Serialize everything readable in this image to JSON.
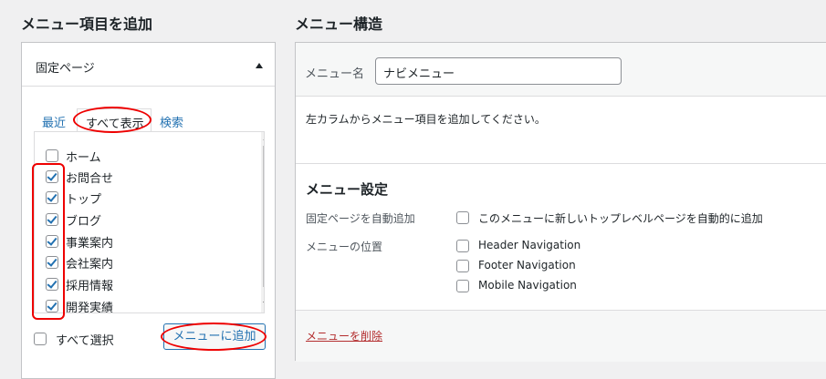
{
  "left": {
    "heading": "メニュー項目を追加",
    "panel_title": "固定ページ",
    "tabs": [
      {
        "label": "最近"
      },
      {
        "label": "すべて表示"
      },
      {
        "label": "検索"
      }
    ],
    "pages": [
      {
        "label": "ホーム",
        "checked": false
      },
      {
        "label": "お問合せ",
        "checked": true
      },
      {
        "label": "トップ",
        "checked": true
      },
      {
        "label": "ブログ",
        "checked": true
      },
      {
        "label": "事業案内",
        "checked": true
      },
      {
        "label": "会社案内",
        "checked": true
      },
      {
        "label": "採用情報",
        "checked": true
      },
      {
        "label": "開発実績",
        "checked": true
      }
    ],
    "select_all_label": "すべて選択",
    "add_button_label": "メニューに追加"
  },
  "right": {
    "heading": "メニュー構造",
    "menu_name_label": "メニュー名",
    "menu_name_value": "ナビメニュー",
    "instruction": "左カラムからメニュー項目を追加してください。",
    "settings_heading": "メニュー設定",
    "auto_add_label": "固定ページを自動追加",
    "auto_add_option": "このメニューに新しいトップレベルページを自動的に追加",
    "location_label": "メニューの位置",
    "locations": [
      {
        "label": "Header Navigation",
        "checked": false
      },
      {
        "label": "Footer Navigation",
        "checked": false
      },
      {
        "label": "Mobile Navigation",
        "checked": false
      }
    ],
    "delete_link": "メニューを削除"
  },
  "colors": {
    "accent": "#2271b1",
    "annotation": "#ee0000",
    "delete": "#b32d2e",
    "background": "#f0f0f1"
  }
}
